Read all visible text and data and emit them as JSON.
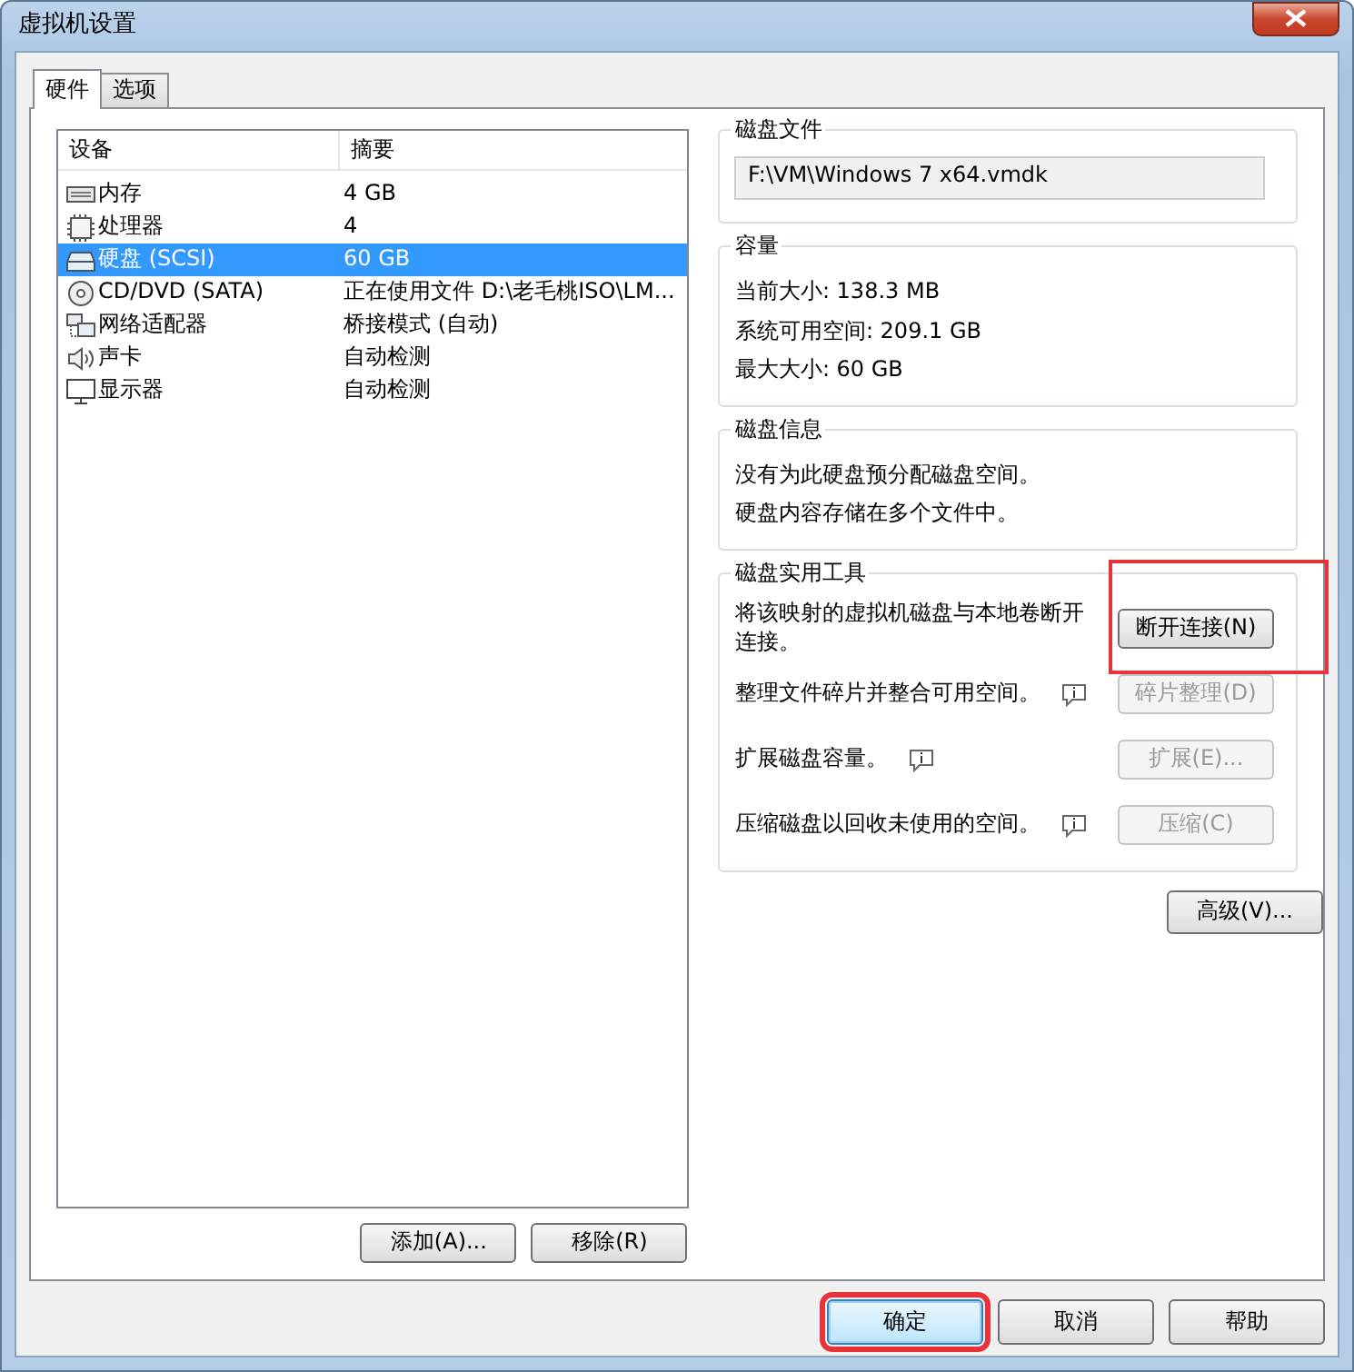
{
  "window": {
    "title": "虚拟机设置"
  },
  "tabs": [
    {
      "label": "硬件",
      "selected": true
    },
    {
      "label": "选项",
      "selected": false
    }
  ],
  "devices": {
    "columns": [
      "设备",
      "摘要"
    ],
    "rows": [
      {
        "kind": "memory",
        "name": "内存",
        "summary": "4 GB",
        "selected": false
      },
      {
        "kind": "cpu",
        "name": "处理器",
        "summary": "4",
        "selected": false
      },
      {
        "kind": "disk",
        "name": "硬盘 (SCSI)",
        "summary": "60 GB",
        "selected": true
      },
      {
        "kind": "cd",
        "name": "CD/DVD (SATA)",
        "summary": "正在使用文件 D:\\老毛桃ISO\\LM...",
        "selected": false
      },
      {
        "kind": "network",
        "name": "网络适配器",
        "summary": "桥接模式 (自动)",
        "selected": false
      },
      {
        "kind": "sound",
        "name": "声卡",
        "summary": "自动检测",
        "selected": false
      },
      {
        "kind": "display",
        "name": "显示器",
        "summary": "自动检测",
        "selected": false
      }
    ]
  },
  "device_buttons": [
    {
      "label": "添加(A)..."
    },
    {
      "label": "移除(R)"
    }
  ],
  "disk_file": {
    "title": "磁盘文件",
    "value": "F:\\VM\\Windows 7 x64.vmdk"
  },
  "capacity": {
    "title": "容量",
    "lines": [
      "当前大小: 138.3 MB",
      "系统可用空间: 209.1 GB",
      "最大大小: 60 GB"
    ]
  },
  "disk_info": {
    "title": "磁盘信息",
    "lines": [
      "没有为此硬盘预分配磁盘空间。",
      "硬盘内容存储在多个文件中。"
    ]
  },
  "utilities": {
    "title": "磁盘实用工具",
    "items": [
      {
        "text": "将该映射的虚拟机磁盘与本地卷断开连接。",
        "info": false,
        "button": "断开连接(N)",
        "disabled": false,
        "highlighted": true
      },
      {
        "text": "整理文件碎片并整合可用空间。",
        "info": true,
        "button": "碎片整理(D)",
        "disabled": true,
        "highlighted": false
      },
      {
        "text": "扩展磁盘容量。",
        "info": true,
        "button": "扩展(E)...",
        "disabled": true,
        "highlighted": false
      },
      {
        "text": "压缩磁盘以回收未使用的空间。",
        "info": true,
        "button": "压缩(C)",
        "disabled": true,
        "highlighted": false
      }
    ]
  },
  "advanced_button": {
    "label": "高级(V)..."
  },
  "footer_buttons": [
    {
      "label": "确定",
      "focused": true,
      "highlighted": true
    },
    {
      "label": "取消",
      "focused": false,
      "highlighted": false
    },
    {
      "label": "帮助",
      "focused": false,
      "highlighted": false
    }
  ]
}
